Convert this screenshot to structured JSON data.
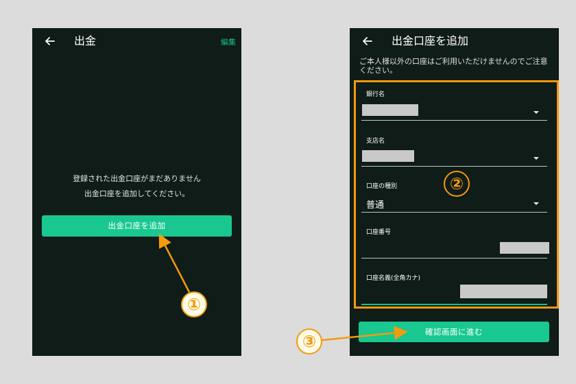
{
  "left_screen": {
    "header": {
      "title": "出金",
      "edit_label": "編集"
    },
    "empty_message_line1": "登録された出金口座がまだありません",
    "empty_message_line2": "出金口座を追加してください。",
    "add_button_label": "出金口座を追加"
  },
  "right_screen": {
    "header": {
      "title": "出金口座を追加"
    },
    "notice": "ご本人様以外の口座はご利用いただけませんのでご注意ください。",
    "fields": {
      "bank_label": "銀行名",
      "branch_label": "支店名",
      "account_type_label": "口座の種別",
      "account_type_value": "普通",
      "account_number_label": "口座番号",
      "account_name_label": "口座名義(全角カナ)"
    },
    "confirm_button_label": "確認画面に進む"
  },
  "annotations": {
    "step1": "①",
    "step2": "②",
    "step3": "③",
    "color": "#f59a0c"
  },
  "colors": {
    "screen_bg": "#0f1c18",
    "accent_green": "#19c890",
    "page_bg": "#dcdcdc"
  },
  "icons": [
    "back-arrow-icon",
    "dropdown-caret-icon"
  ]
}
